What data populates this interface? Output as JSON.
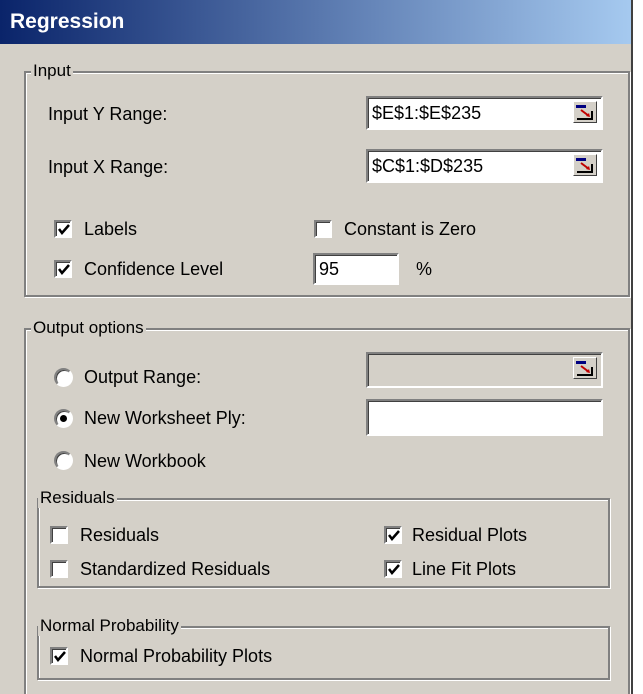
{
  "dialog": {
    "title": "Regression"
  },
  "input": {
    "group_label": "Input",
    "y_range": {
      "label": "Input Y Range:",
      "value": "$E$1:$E$235"
    },
    "x_range": {
      "label": "Input X Range:",
      "value": "$C$1:$D$235"
    },
    "labels": {
      "label": "Labels",
      "checked": true
    },
    "constant_is_zero": {
      "label": "Constant is Zero",
      "checked": false
    },
    "confidence_level": {
      "label": "Confidence Level",
      "checked": true,
      "value": "95",
      "unit": "%"
    }
  },
  "output": {
    "group_label": "Output options",
    "output_range": {
      "label": "Output Range:",
      "selected": false,
      "value": ""
    },
    "new_worksheet_ply": {
      "label": "New Worksheet Ply:",
      "selected": true,
      "value": ""
    },
    "new_workbook": {
      "label": "New Workbook",
      "selected": false
    }
  },
  "residuals": {
    "group_label": "Residuals",
    "residuals": {
      "label": "Residuals",
      "checked": false
    },
    "standardized_residuals": {
      "label": "Standardized Residuals",
      "checked": false
    },
    "residual_plots": {
      "label": "Residual Plots",
      "checked": true
    },
    "line_fit_plots": {
      "label": "Line Fit Plots",
      "checked": true
    }
  },
  "normal_probability": {
    "group_label": "Normal Probability",
    "normal_probability_plots": {
      "label": "Normal Probability Plots",
      "checked": true
    }
  }
}
